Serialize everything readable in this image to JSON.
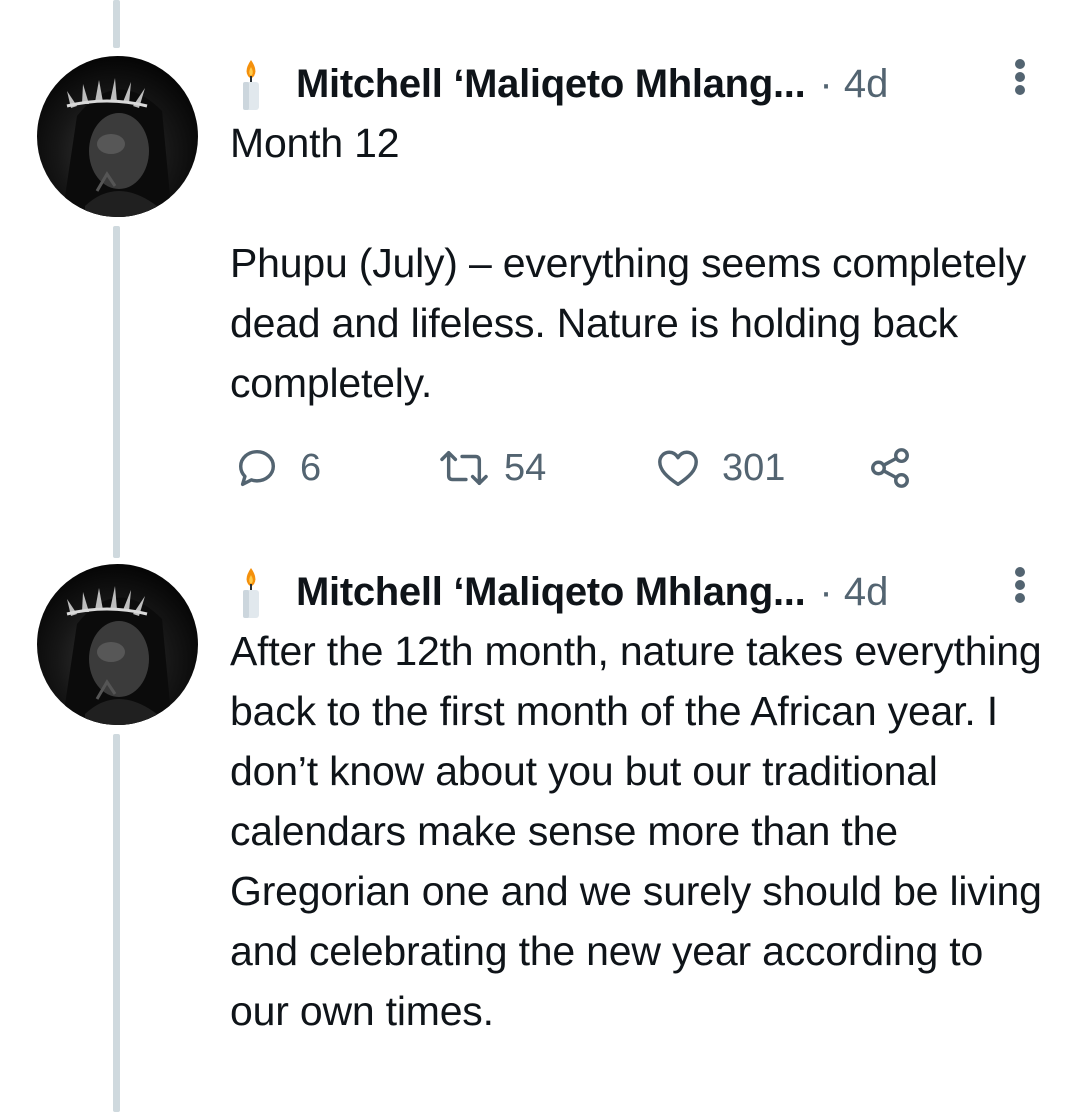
{
  "tweets": [
    {
      "author": {
        "display_name": "Mitchell ‘Maliqeto Mhlang...",
        "badge_icon": "candle-icon",
        "avatar": "avatar-woman-crown"
      },
      "meta": "· 4d",
      "text": "Month 12\n\nPhupu (July) – everything seems completely dead and lifeless. Nature is holding back completely.",
      "actions": {
        "replies": "6",
        "retweets": "54",
        "likes": "301"
      }
    },
    {
      "author": {
        "display_name": "Mitchell ‘Maliqeto Mhlang...",
        "badge_icon": "candle-icon",
        "avatar": "avatar-woman-crown"
      },
      "meta": "· 4d",
      "text": "After the 12th month, nature takes everything back to the first month of the African year. I don’t know about you but our traditional calendars make sense more than the Gregorian one and we surely should be living and celebrating the new year according to our own times."
    }
  ],
  "colors": {
    "text": "#0f1419",
    "secondary": "#536471",
    "thread_line": "#cfd9de",
    "candle_flame": "#f4900c"
  }
}
